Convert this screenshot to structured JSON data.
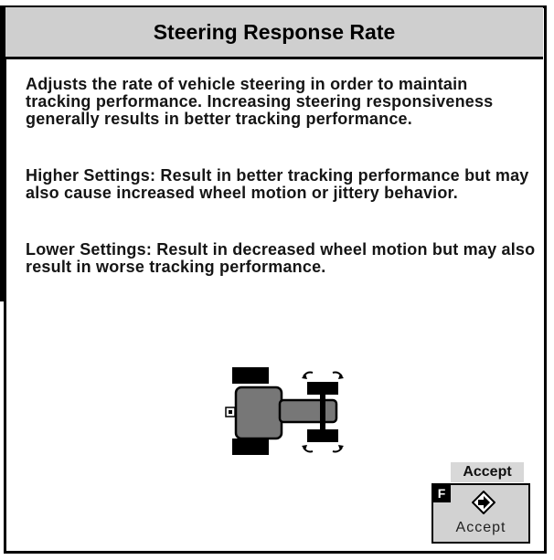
{
  "window": {
    "title": "Steering Response Rate"
  },
  "body": {
    "paragraphs": [
      "Adjusts the rate of vehicle steering in order to maintain tracking performance.  Increasing steering responsiveness generally results in better tracking performance.",
      "Higher Settings:  Result in better tracking performance but may also cause increased wheel motion or jittery behavior.",
      "Lower Settings:  Result in decreased wheel motion but may also result in worse tracking performance."
    ]
  },
  "illustration": {
    "icon": "tractor-steering-icon"
  },
  "footer": {
    "accept_label": "Accept",
    "accept_button": {
      "key": "F",
      "icon": "diamond-arrow-icon",
      "label": "Accept"
    }
  },
  "colors": {
    "title_bg": "#cfcfcf",
    "button_bg": "#d2d2d2",
    "border": "#000000"
  }
}
